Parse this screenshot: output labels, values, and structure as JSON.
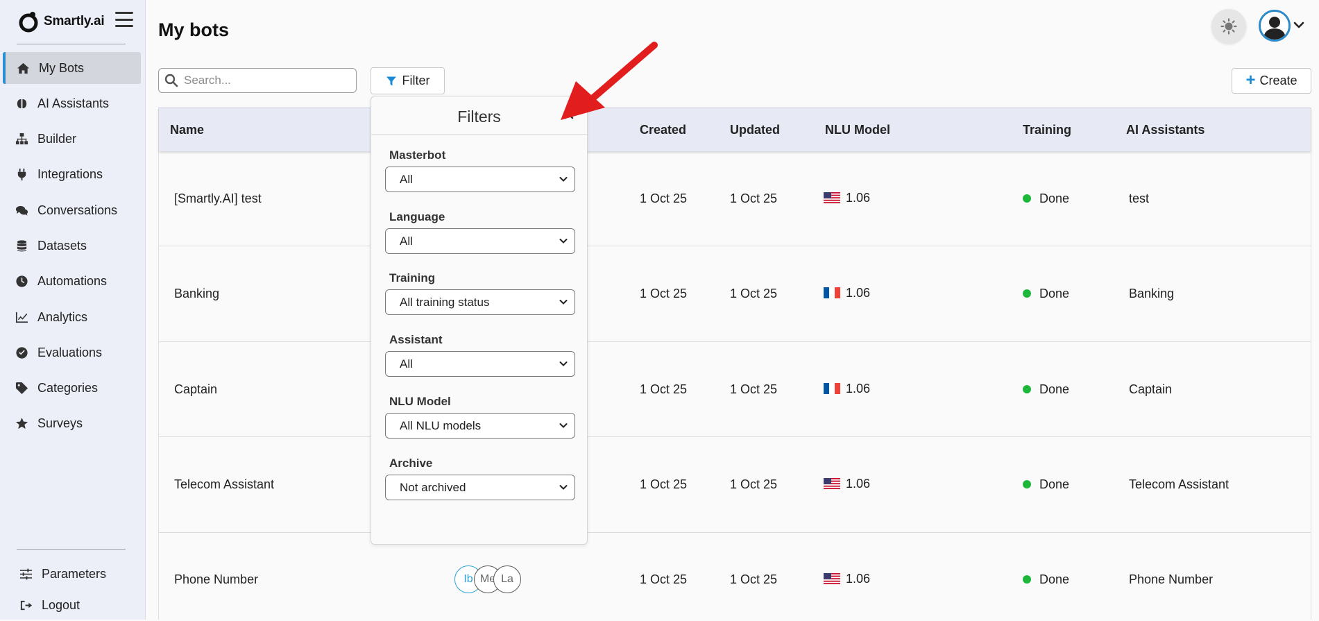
{
  "app": {
    "logo_text": "Smartly.ai"
  },
  "sidebar": {
    "items": [
      {
        "label": "My Bots",
        "icon": "home-icon",
        "active": true
      },
      {
        "label": "AI Assistants",
        "icon": "brain-icon"
      },
      {
        "label": "Builder",
        "icon": "sitemap-icon"
      },
      {
        "label": "Integrations",
        "icon": "plug-icon"
      },
      {
        "label": "Conversations",
        "icon": "comments-icon"
      },
      {
        "label": "Datasets",
        "icon": "database-icon"
      },
      {
        "label": "Automations",
        "icon": "clock-icon"
      },
      {
        "label": "Analytics",
        "icon": "chart-line-icon"
      },
      {
        "label": "Evaluations",
        "icon": "check-circle-icon"
      },
      {
        "label": "Categories",
        "icon": "tag-icon"
      },
      {
        "label": "Surveys",
        "icon": "star-icon"
      }
    ],
    "bottom": [
      {
        "label": "Parameters",
        "icon": "sliders-icon"
      },
      {
        "label": "Logout",
        "icon": "logout-icon"
      }
    ]
  },
  "header": {
    "title": "My bots"
  },
  "toolbar": {
    "search_placeholder": "Search...",
    "filter_label": "Filter",
    "create_label": "Create"
  },
  "table": {
    "columns": {
      "name": "Name",
      "created": "Created",
      "updated": "Updated",
      "nlu_model": "NLU Model",
      "training": "Training",
      "ai_assistants": "AI Assistants"
    },
    "rows": [
      {
        "name": "[Smartly.AI] test",
        "created": "1 Oct 25",
        "updated": "1 Oct 25",
        "flag": "us",
        "nlu": "1.06",
        "training": "Done",
        "assistants": "test"
      },
      {
        "name": "Banking",
        "created": "1 Oct 25",
        "updated": "1 Oct 25",
        "flag": "fr",
        "nlu": "1.06",
        "training": "Done",
        "assistants": "Banking"
      },
      {
        "name": "Captain",
        "created": "1 Oct 25",
        "updated": "1 Oct 25",
        "flag": "fr",
        "nlu": "1.06",
        "training": "Done",
        "assistants": "Captain"
      },
      {
        "name": "Telecom Assistant",
        "created": "1 Oct 25",
        "updated": "1 Oct 25",
        "flag": "us",
        "nlu": "1.06",
        "training": "Done",
        "assistants": "Telecom Assistant"
      },
      {
        "name": "Phone Number",
        "created": "1 Oct 25",
        "updated": "1 Oct 25",
        "flag": "us",
        "nlu": "1.06",
        "training": "Done",
        "assistants": "Phone Number",
        "users": [
          "Ib",
          "Me",
          "La"
        ]
      }
    ],
    "status_color": "#1db83b"
  },
  "filters": {
    "title": "Filters",
    "groups": [
      {
        "label": "Masterbot",
        "value": "All"
      },
      {
        "label": "Language",
        "value": "All"
      },
      {
        "label": "Training",
        "value": "All training status"
      },
      {
        "label": "Assistant",
        "value": "All"
      },
      {
        "label": "NLU Model",
        "value": "All NLU models"
      },
      {
        "label": "Archive",
        "value": "Not archived"
      }
    ]
  },
  "colors": {
    "accent": "#2b8fd6",
    "annotation_arrow": "#e11d1d"
  }
}
